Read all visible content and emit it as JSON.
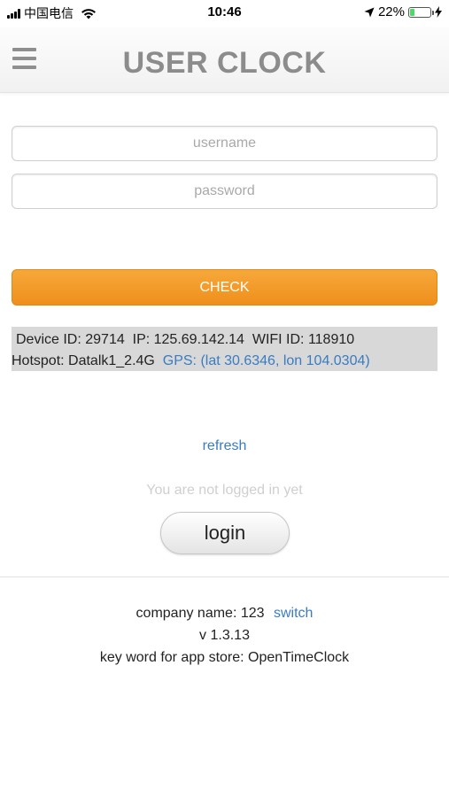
{
  "status_bar": {
    "carrier": "中国电信",
    "time": "10:46",
    "battery": "22%",
    "battery_level": 0.22,
    "battery_color": "#4cd964"
  },
  "header": {
    "title": "USER CLOCK",
    "menu_icon": "hamburger-menu-icon"
  },
  "form": {
    "username_placeholder": "username",
    "password_placeholder": "password",
    "check_label": "CHECK",
    "check_color": "#f39a2b"
  },
  "info": {
    "device_id": "Device ID: 29714",
    "ip": "IP: 125.69.142.14",
    "wifi_id": "WIFI ID: 118910",
    "hotspot": "Hotspot: Datalk1_2.4G",
    "gps": "GPS: (lat 30.6346, lon 104.0304)"
  },
  "refresh_label": "refresh",
  "login_status": "You are not logged in yet",
  "login_label": "login",
  "footer": {
    "company_label": "company name: 123",
    "switch_label": "switch",
    "version": "v 1.3.13",
    "keyword": "key word for app store: OpenTimeClock"
  },
  "colors": {
    "link": "#3a7cc1",
    "title": "#8c8c8c",
    "info_background": "#d8d8d8"
  }
}
